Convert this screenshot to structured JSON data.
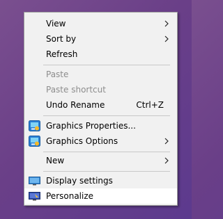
{
  "menu": {
    "view": "View",
    "sort_by": "Sort by",
    "refresh": "Refresh",
    "paste": "Paste",
    "paste_shortcut": "Paste shortcut",
    "undo_rename": "Undo Rename",
    "undo_rename_shortcut": "Ctrl+Z",
    "graphics_properties": "Graphics Properties...",
    "graphics_options": "Graphics Options",
    "new": "New",
    "display_settings": "Display settings",
    "personalize": "Personalize"
  },
  "icons": {
    "graphics": "intel-graphics-icon",
    "display": "display-monitor-icon",
    "personalize": "personalize-screen-icon",
    "submenu": "chevron-right-icon"
  },
  "colors": {
    "desktop_background": "#6a3f88",
    "menu_background": "#f1f1f1",
    "disabled_text": "#8d8d8d",
    "hover_background": "#ffffff"
  }
}
